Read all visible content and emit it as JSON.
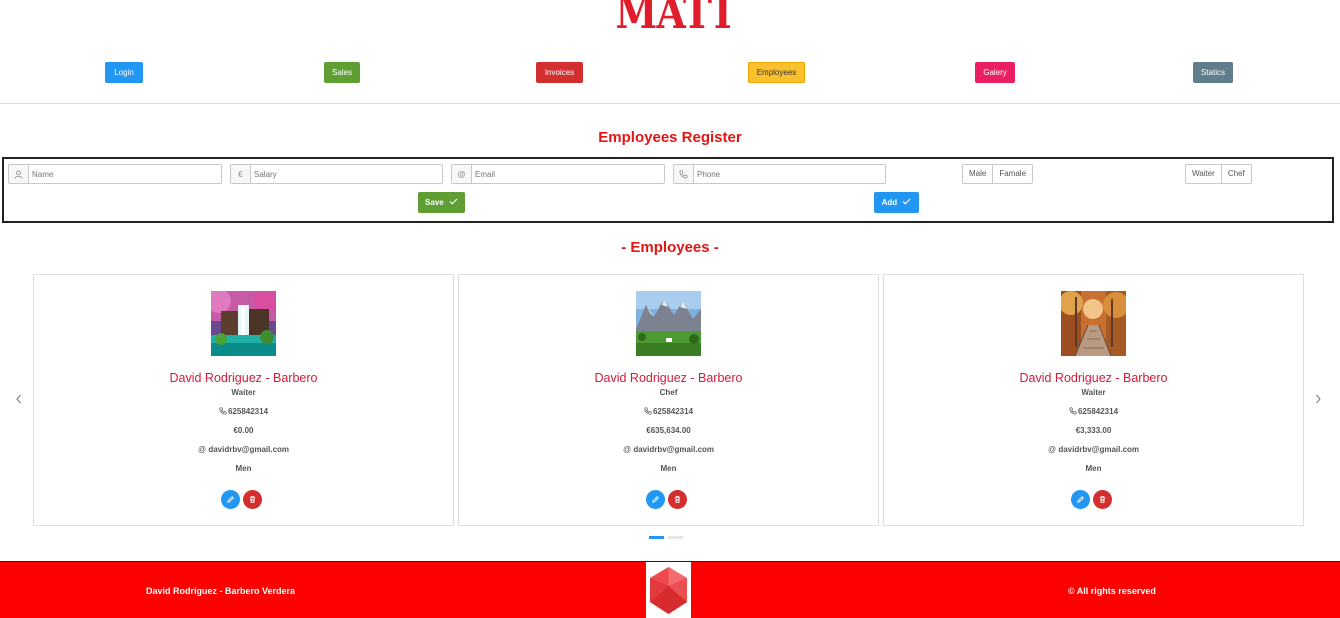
{
  "header": {
    "logo_text": "MATTERS"
  },
  "nav": [
    {
      "label": "Login",
      "color": "#2196f3"
    },
    {
      "label": "Sales",
      "color": "#5f9e32"
    },
    {
      "label": "Invoices",
      "color": "#d32f2f"
    },
    {
      "label": "Employees",
      "color": "#fbc02d"
    },
    {
      "label": "Galery",
      "color": "#e91e63"
    },
    {
      "label": "Statics",
      "color": "#607d8b"
    }
  ],
  "register": {
    "title": "Employees Register",
    "name_placeholder": "Name",
    "salary_placeholder": "Salary",
    "email_placeholder": "Email",
    "phone_placeholder": "Phone",
    "gender_options": [
      "Male",
      "Famale"
    ],
    "role_options": [
      "Waiter",
      "Chef"
    ],
    "save_label": "Save",
    "add_label": "Add",
    "salary_icon": "€",
    "email_icon": "@"
  },
  "employees_section": {
    "title": "- Employees -",
    "cards": [
      {
        "name": "David Rodriguez - Barbero",
        "role": "Waiter",
        "phone": "625842314",
        "salary": "€0.00",
        "email": "davidrbv@gmail.com",
        "gender": "Men",
        "photo": "waterfall"
      },
      {
        "name": "David Rodriguez - Barbero",
        "role": "Chef",
        "phone": "625842314",
        "salary": "€635,634.00",
        "email": "davidrbv@gmail.com",
        "gender": "Men",
        "photo": "mountains"
      },
      {
        "name": "David Rodriguez - Barbero",
        "role": "Waiter",
        "phone": "625842314",
        "salary": "€3,333.00",
        "email": "davidrbv@gmail.com",
        "gender": "Men",
        "photo": "autumn-path"
      }
    ],
    "email_prefix": "@",
    "active_page": 1,
    "page_count": 2
  },
  "footer": {
    "left_text": "David Rodríguez - Barbero Verdera",
    "right_text": "© All rights reserved"
  },
  "colors": {
    "accent_red": "#e31515",
    "footer_red": "#ff0000",
    "name_red": "#d41b3b",
    "edit_blue": "#2196f3",
    "delete_red": "#d32f2f",
    "save_green": "#5f9e32"
  }
}
